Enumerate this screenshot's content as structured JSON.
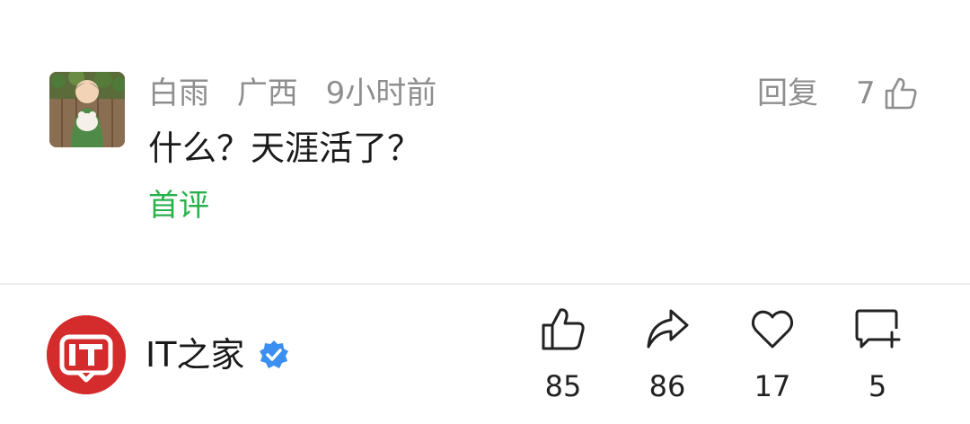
{
  "comment": {
    "user_name": "白雨",
    "location": "广西",
    "time": "9小时前",
    "reply_label": "回复",
    "like_count": "7",
    "text": "什么？天涯活了？",
    "badge": "首评"
  },
  "footer": {
    "account_name": "IT之家",
    "logo_text": "IT",
    "likes": "85",
    "shares": "86",
    "favorites": "17",
    "comments": "5"
  },
  "icons": {
    "thumbs_up": "thumbs-up-icon",
    "share": "share-arrow-icon",
    "heart": "heart-icon",
    "comment_add": "comment-add-icon",
    "verified": "verified-badge-icon"
  },
  "colors": {
    "accent_green": "#28b24b",
    "brand_red": "#d42c2c",
    "verified_blue": "#3a8ff0",
    "meta_gray": "#8e8e8e"
  }
}
